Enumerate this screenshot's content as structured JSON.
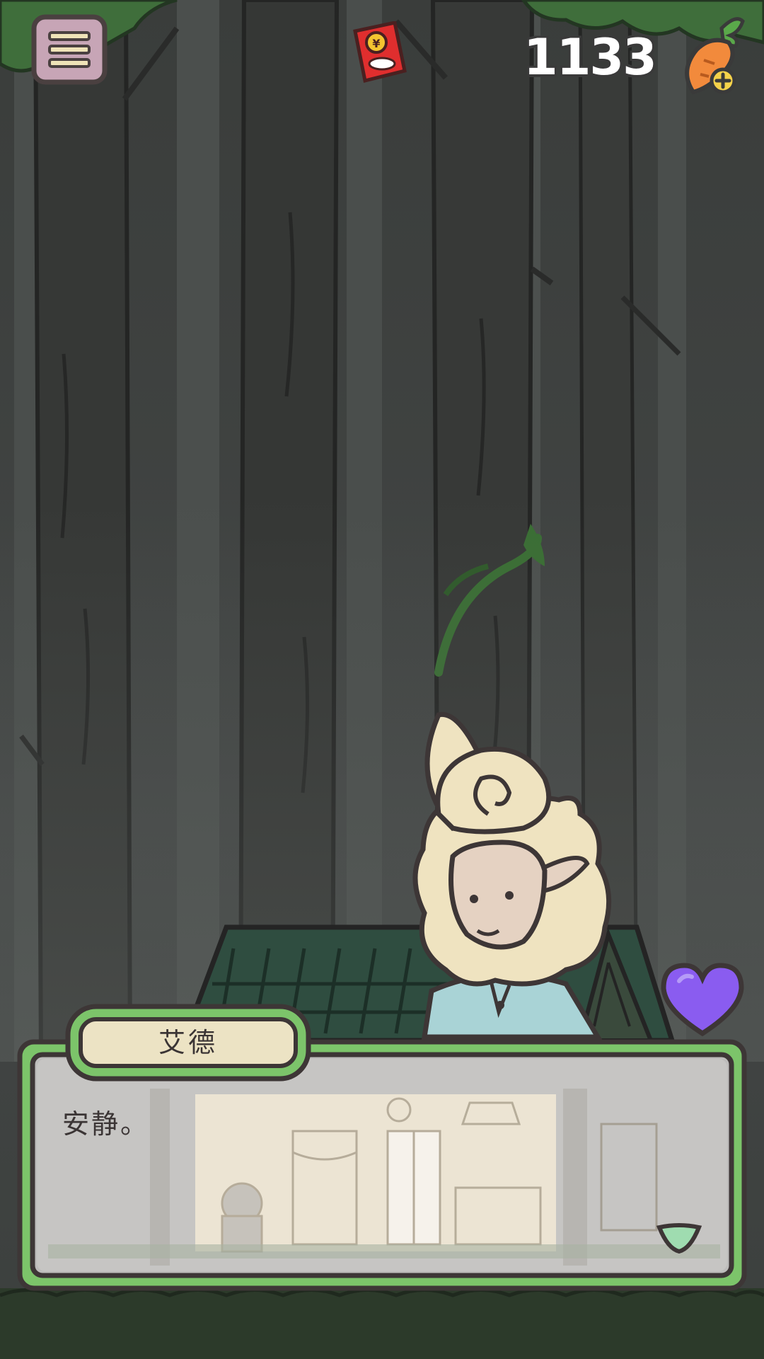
{
  "hud": {
    "carrot_count": "1133",
    "menu_icon": "menu-icon",
    "event_icon": "red-envelope-icon",
    "add_currency_icon": "carrot-plus-icon"
  },
  "dialogue": {
    "speaker_name": "艾德",
    "text": "安静。",
    "continue_icon": "continue-arrow-icon"
  },
  "affinity": {
    "icon": "purple-heart-icon",
    "color": "#8a5cf0"
  },
  "colors": {
    "dialogue_frame": "#7cc46a",
    "frame_outline": "#3d3636",
    "name_plate": "#ece3c4",
    "forest_bg": "#3a3e3c"
  }
}
